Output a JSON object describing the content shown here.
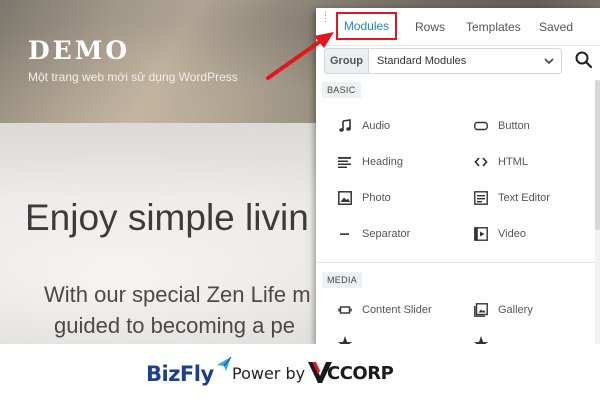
{
  "site": {
    "title": "DEMO",
    "tagline": "Một trang web mới sử dụng WordPress",
    "hero_heading": "Enjoy simple livin",
    "hero_line1": "With our special Zen Life m",
    "hero_line2": "guided to becoming a pe"
  },
  "panel": {
    "tabs": [
      {
        "label": "Modules",
        "active": true
      },
      {
        "label": "Rows",
        "active": false
      },
      {
        "label": "Templates",
        "active": false
      },
      {
        "label": "Saved",
        "active": false
      }
    ],
    "group": {
      "label": "Group",
      "selected": "Standard Modules"
    },
    "sections": [
      {
        "label": "BASIC",
        "modules": [
          {
            "label": "Audio",
            "icon": "music-note-icon"
          },
          {
            "label": "Button",
            "icon": "button-icon"
          },
          {
            "label": "Heading",
            "icon": "heading-icon"
          },
          {
            "label": "HTML",
            "icon": "code-icon"
          },
          {
            "label": "Photo",
            "icon": "photo-icon"
          },
          {
            "label": "Text Editor",
            "icon": "text-editor-icon"
          },
          {
            "label": "Separator",
            "icon": "separator-icon"
          },
          {
            "label": "Video",
            "icon": "video-icon"
          }
        ]
      },
      {
        "label": "MEDIA",
        "modules": [
          {
            "label": "Content Slider",
            "icon": "slider-icon"
          },
          {
            "label": "Gallery",
            "icon": "gallery-icon"
          }
        ]
      }
    ]
  },
  "annotation": {
    "color": "#e3161f"
  },
  "footer": {
    "brand": "BizFly",
    "power_by": "Power by",
    "partner": "CCORP"
  },
  "colors": {
    "accent": "#1e88c7",
    "highlight": "#e3161f",
    "bizfly_blue": "#1d3f8f"
  }
}
